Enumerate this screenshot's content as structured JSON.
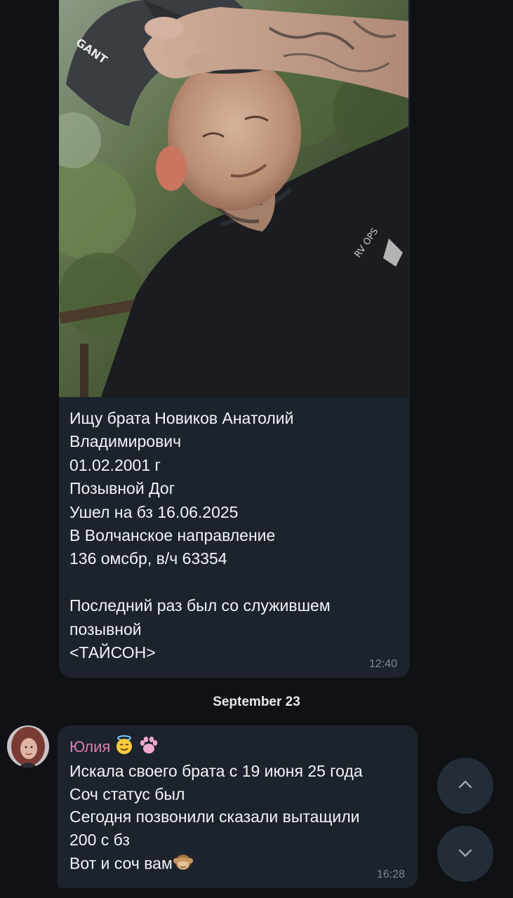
{
  "message_1": {
    "caption_lines": [
      "Ищу брата Новиков Анатолий",
      "Владимирович",
      "01.02.2001 г",
      "Позывной Дог",
      "Ушел на бз 16.06.2025",
      "В Волчанское направление",
      "136 омсбр, в/ч 63354",
      "",
      "Последний раз был со служившем",
      "позывной",
      "<ТАЙСОН>"
    ],
    "time": "12:40",
    "photo": {
      "cap_brand": "GANT",
      "shirt_print": "RV OPS"
    }
  },
  "date_separator": "September 23",
  "message_2": {
    "sender": "Юлия",
    "sender_badges": [
      "smiling-face-with-halo-emoji",
      "paw-prints-emoji"
    ],
    "lines": [
      "Искала своего брата с 19 июня 25 года",
      "Соч статус был",
      "Сегодня позвонили сказали вытащили",
      "200 с бз",
      "Вот и соч вам"
    ],
    "trailing_emoji": "see-no-evil-monkey-emoji",
    "time": "16:28"
  },
  "scroll_buttons": {
    "up_icon": "chevron-up-icon",
    "down_icon": "chevron-down-icon"
  },
  "colors": {
    "background": "#0f1114",
    "bubble": "#1c232c",
    "sender_name": "#e07bb5",
    "time_text": "#7e8893",
    "scroll_button": "#242d37"
  }
}
